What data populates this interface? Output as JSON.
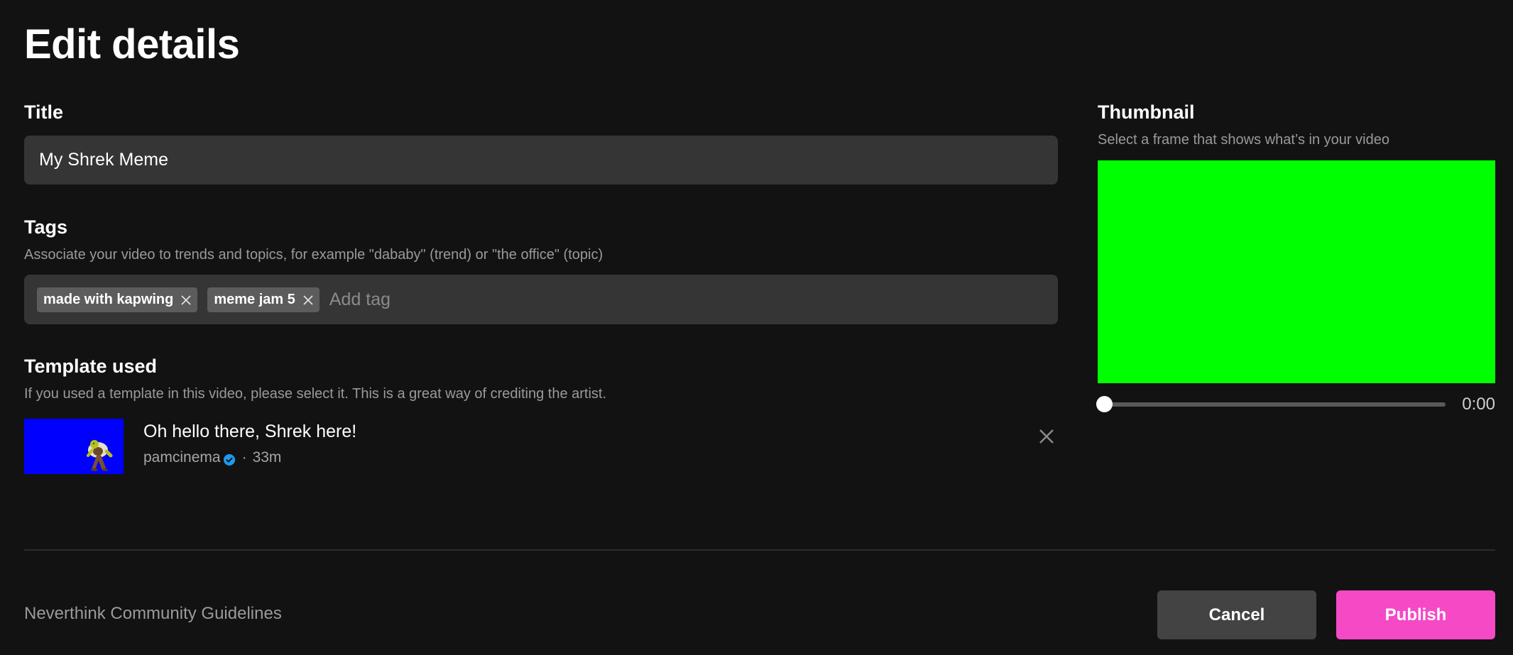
{
  "page": {
    "title": "Edit details"
  },
  "title_field": {
    "label": "Title",
    "value": "My Shrek Meme"
  },
  "tags": {
    "label": "Tags",
    "help": "Associate your video to trends and topics, for example \"dababy\" (trend) or \"the office\" (topic)",
    "items": [
      {
        "label": "made with kapwing",
        "remove_icon": "close-icon"
      },
      {
        "label": "meme jam 5",
        "remove_icon": "close-icon"
      }
    ],
    "input_placeholder": "Add tag"
  },
  "template": {
    "label": "Template used",
    "help": "If you used a template in this video, please select it. This is a great way of crediting the artist.",
    "selected": {
      "title": "Oh hello there, Shrek here!",
      "author": "pamcinema",
      "verified": true,
      "separator": "·",
      "age": "33m",
      "thumbnail_background": "#0000ff",
      "thumbnail_subject": "shrek-figure"
    },
    "remove_icon": "close-icon"
  },
  "thumbnail": {
    "label": "Thumbnail",
    "help": "Select a frame that shows what’s in your video",
    "frame_color": "#00ff00",
    "slider_position": 0,
    "time": "0:00"
  },
  "footer": {
    "guidelines_link": "Neverthink Community Guidelines",
    "cancel_label": "Cancel",
    "publish_label": "Publish"
  },
  "colors": {
    "background": "#121212",
    "field": "#353535",
    "chip": "#5c5c5c",
    "publish": "#f549c6",
    "cancel": "#434343",
    "verified": "#1d9bf0"
  }
}
